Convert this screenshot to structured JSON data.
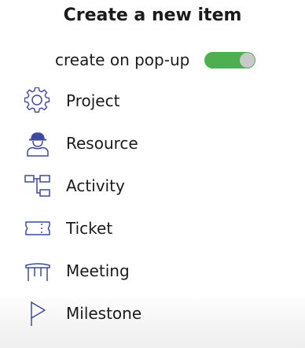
{
  "header": {
    "title": "Create a new item"
  },
  "popup_toggle": {
    "label": "create on pop-up",
    "state": "on",
    "on_color": "#4caf50"
  },
  "items": [
    {
      "label": "Project",
      "icon": "gear-icon"
    },
    {
      "label": "Resource",
      "icon": "worker-icon"
    },
    {
      "label": "Activity",
      "icon": "hierarchy-icon"
    },
    {
      "label": "Ticket",
      "icon": "ticket-icon"
    },
    {
      "label": "Meeting",
      "icon": "table-icon"
    },
    {
      "label": "Milestone",
      "icon": "flag-icon"
    }
  ],
  "colors": {
    "icon_stroke": "#3f4a9e",
    "text": "#1b1b1b"
  }
}
